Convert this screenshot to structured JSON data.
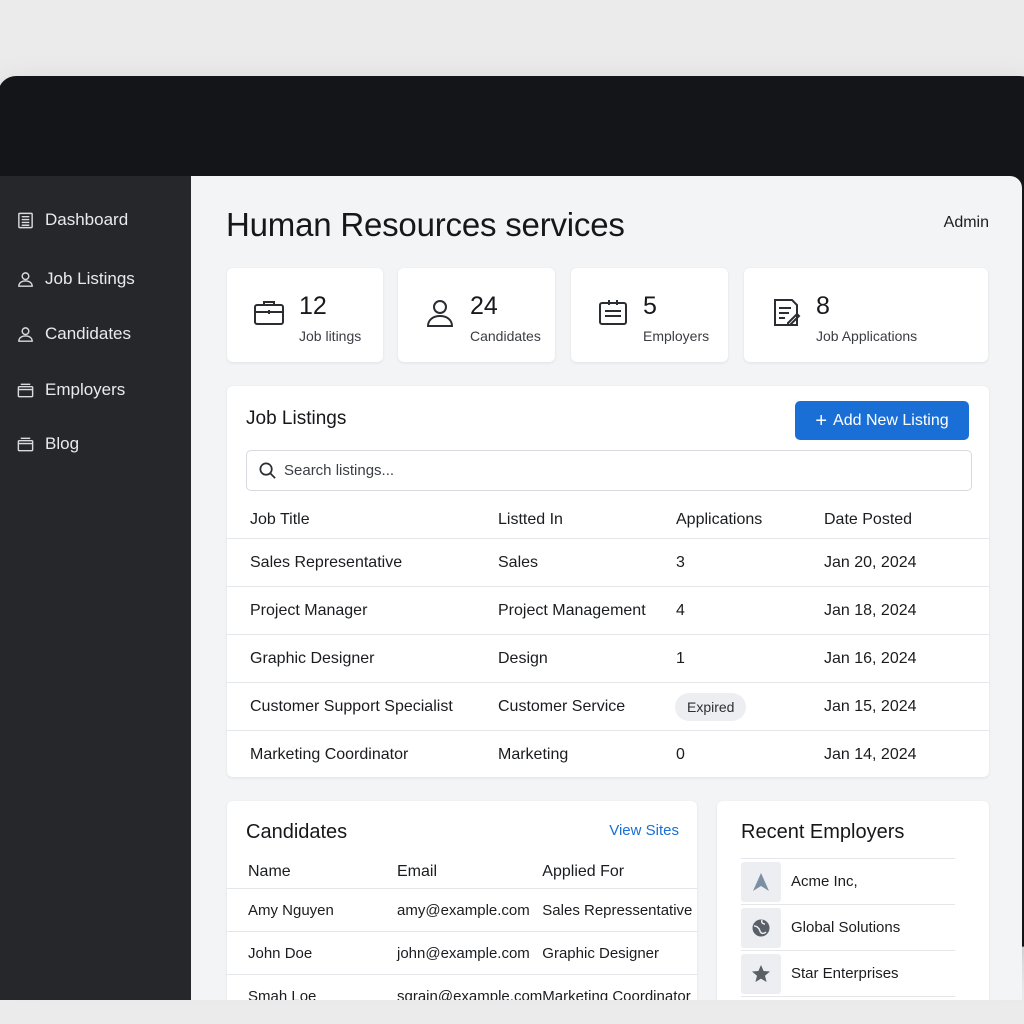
{
  "sidebar": {
    "items": [
      {
        "label": "Dashboard",
        "icon": "building-icon"
      },
      {
        "label": "Job Listings",
        "icon": "user-icon"
      },
      {
        "label": "Candidates",
        "icon": "user-icon"
      },
      {
        "label": "Employers",
        "icon": "folder-icon"
      },
      {
        "label": "Blog",
        "icon": "folder-icon"
      }
    ]
  },
  "header": {
    "title": "Human Resources services",
    "user": "Admin"
  },
  "stats": [
    {
      "value": "12",
      "label": "Job litings",
      "icon": "briefcase-icon"
    },
    {
      "value": "24",
      "label": "Candidates",
      "icon": "person-icon"
    },
    {
      "value": "5",
      "label": "Employers",
      "icon": "id-card-icon"
    },
    {
      "value": "8",
      "label": "Job Applications",
      "icon": "document-edit-icon"
    }
  ],
  "job_listings": {
    "title": "Job Listings",
    "add_button": "Add New Listing",
    "search_placeholder": "Search listings...",
    "columns": [
      "Job Title",
      "Listted In",
      "Applications",
      "Date Posted"
    ],
    "rows": [
      {
        "title": "Sales Representative",
        "category": "Sales",
        "applications": "3",
        "date": "Jan 20, 2024"
      },
      {
        "title": "Project Manager",
        "category": "Project Management",
        "applications": "4",
        "date": "Jan 18, 2024"
      },
      {
        "title": "Graphic Designer",
        "category": "Design",
        "applications": "1",
        "date": "Jan 16, 2024"
      },
      {
        "title": "Customer Support Specialist",
        "category": "Customer Service",
        "applications": "Expired",
        "date": "Jan 15, 2024"
      },
      {
        "title": "Marketing Coordinator",
        "category": "Marketing",
        "applications": "0",
        "date": "Jan 14, 2024"
      }
    ]
  },
  "candidates": {
    "title": "Candidates",
    "link": "View Sites",
    "columns": [
      "Name",
      "Email",
      "Applied For"
    ],
    "rows": [
      {
        "name": "Amy Nguyen",
        "email": "amy@example.com",
        "applied": "Sales Repressentative"
      },
      {
        "name": "John Doe",
        "email": "john@example.com",
        "applied": "Graphic Designer"
      },
      {
        "name": "Smah Loe",
        "email": "sgrain@example.com",
        "applied": "Marketing Coordinator"
      }
    ]
  },
  "employers": {
    "title": "Recent Employers",
    "items": [
      {
        "name": "Acme Inc,",
        "icon": "arrow-logo-icon"
      },
      {
        "name": "Global Solutions",
        "icon": "globe-logo-icon"
      },
      {
        "name": "Star Enterprises",
        "icon": "star-logo-icon"
      }
    ]
  },
  "colors": {
    "accent": "#1a6fd6",
    "sidebar": "#25272b",
    "background": "#f3f4f6"
  }
}
